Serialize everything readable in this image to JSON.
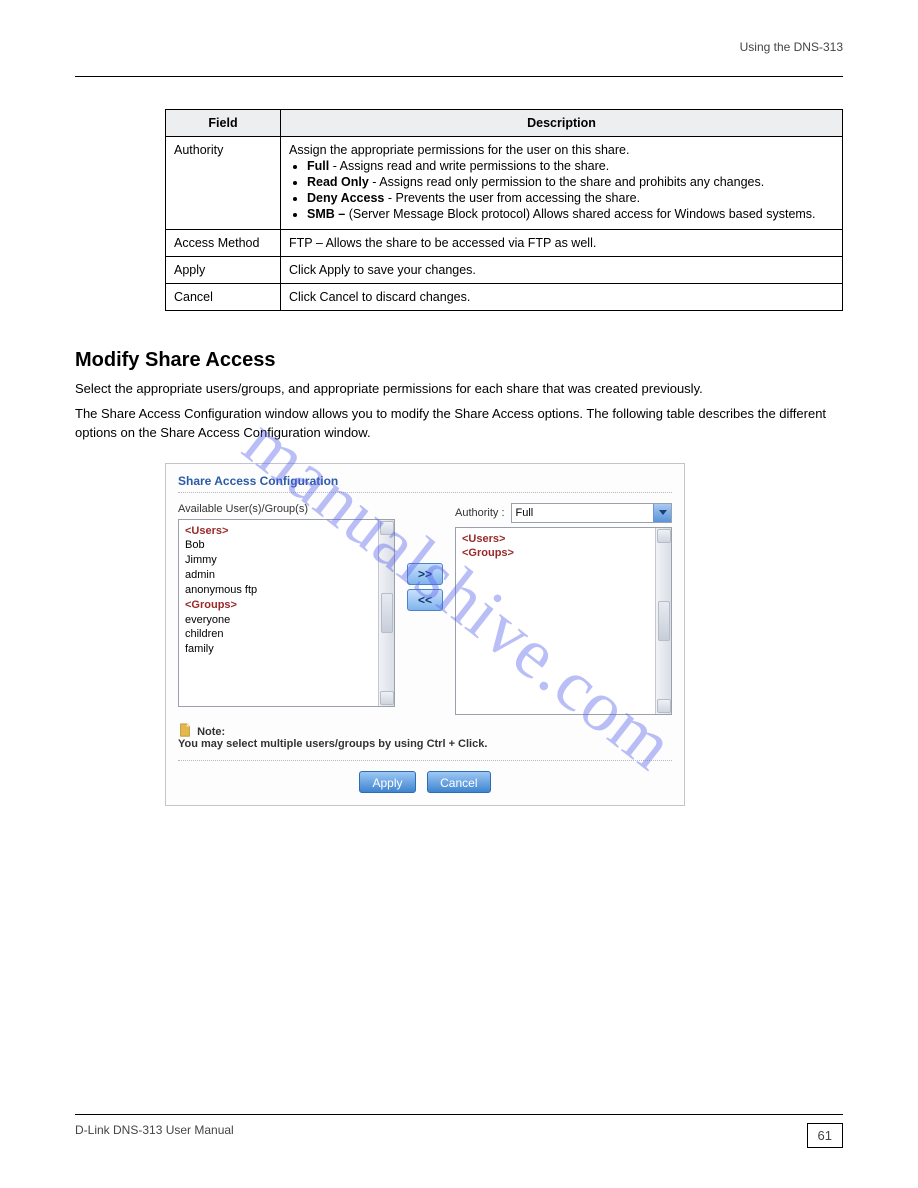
{
  "header": {
    "right": "Using the DNS-313"
  },
  "watermark": "manualshive.com",
  "table": {
    "headers": [
      "Field",
      "Description"
    ],
    "rows": [
      {
        "label": "Authority",
        "desc_lead": "Assign the appropriate permissions for the user on this share.",
        "bullets": [
          {
            "b": "Full",
            "t": " - Assigns read and write permissions to the share."
          },
          {
            "b": "Read Only",
            "t": " - Assigns read only permission to the share and prohibits any changes."
          },
          {
            "b": "Deny Access",
            "t": " - Prevents the user from accessing the share."
          },
          {
            "b": "SMB – ",
            "t": "(Server Message Block protocol) Allows shared access for Windows based systems."
          }
        ]
      },
      {
        "label": "Access Method",
        "desc": "FTP – Allows the share to be accessed via FTP as well."
      },
      {
        "label": "Apply",
        "desc": "Click Apply to save your changes."
      },
      {
        "label": "Cancel",
        "desc": "Click Cancel to discard changes."
      }
    ]
  },
  "section_heading": "Modify Share Access",
  "paragraphs": [
    "Select the appropriate users/groups, and appropriate permissions for each share that was created previously.",
    "The Share Access Configuration window allows you to modify the Share Access options. The following table describes the different options on the Share Access Configuration window."
  ],
  "shot": {
    "title": "Share Access Configuration",
    "available_label": "Available User(s)/Group(s)",
    "authority_label": "Authority :",
    "authority_value": "Full",
    "left_list": {
      "users_header": "<Users>",
      "users": [
        "Bob",
        "Jimmy",
        "admin",
        "anonymous ftp"
      ],
      "groups_header": "<Groups>",
      "groups": [
        "everyone",
        "children",
        "family"
      ]
    },
    "right_list": {
      "users_header": "<Users>",
      "groups_header": "<Groups>"
    },
    "move_right": ">>",
    "move_left": "<<",
    "note_label": "Note:",
    "note_text": "You may select multiple users/groups by using Ctrl + Click.",
    "apply": "Apply",
    "cancel": "Cancel"
  },
  "footer": {
    "left": "D-Link DNS-313 User Manual",
    "page": "61"
  }
}
